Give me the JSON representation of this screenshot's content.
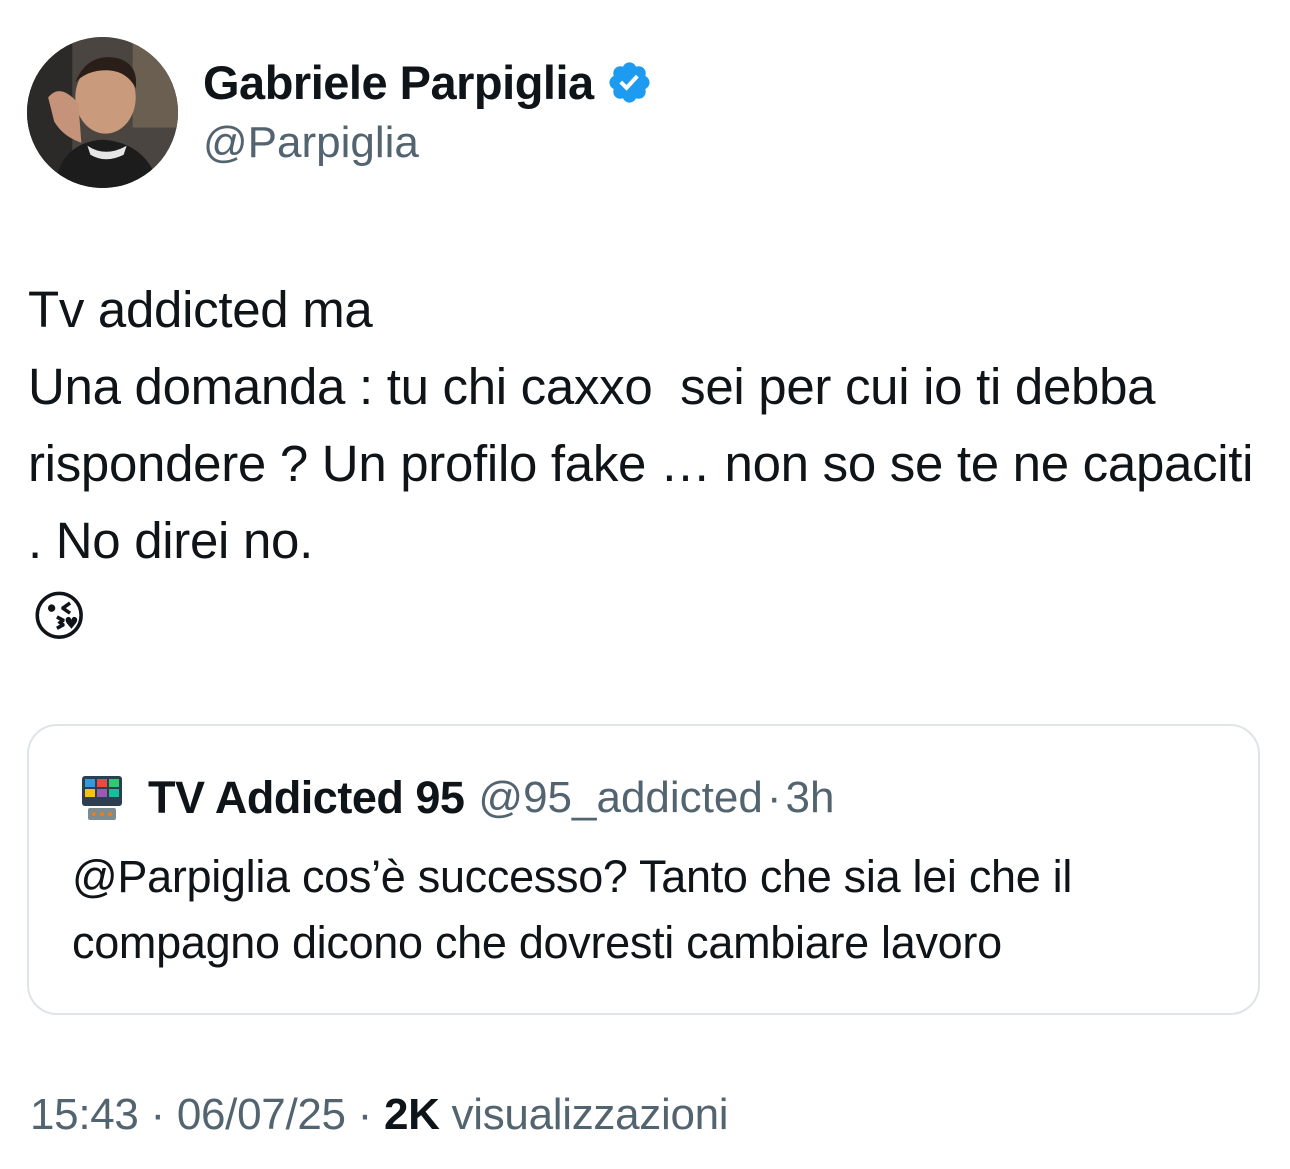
{
  "author": {
    "display_name": "Gabriele Parpiglia",
    "handle": "@Parpiglia",
    "verified_icon": "verified-badge-icon",
    "badge_color": "#1d9bf0"
  },
  "tweet": {
    "text": "Tv addicted ma\nUna domanda : tu chi caxxo  sei per cui io ti debba rispondere ? Un profilo fake … non so se te ne capaciti . No direi no.",
    "emoji": "😘"
  },
  "quoted_tweet": {
    "display_name": "TV Addicted 95",
    "handle": "@95_addicted",
    "separator": "·",
    "time": "3h",
    "text": "@Parpiglia cos’è successo? Tanto che sia lei che il compagno dicono che dovresti cambiare lavoro"
  },
  "meta": {
    "time": "15:43",
    "separator": "·",
    "date": "06/07/25",
    "views_count": "2K",
    "views_label": "visualizzazioni"
  },
  "colors": {
    "text_primary": "#0f1419",
    "text_secondary": "#536471",
    "border": "#dfe4e8"
  }
}
